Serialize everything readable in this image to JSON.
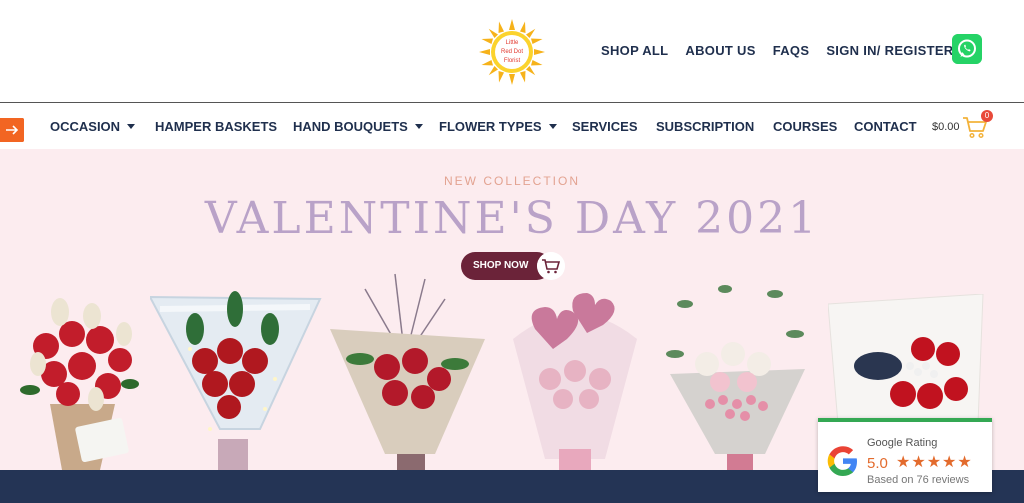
{
  "brand": {
    "logo_text": [
      "Little",
      "Red Dot",
      "Florist"
    ]
  },
  "top_nav": [
    "SHOP ALL",
    "ABOUT US",
    "FAQS",
    "SIGN IN/ REGISTER"
  ],
  "icons": {
    "menu_toggle": "arrow-right-icon",
    "whatsapp": "whatsapp-icon",
    "cart": "cart-icon",
    "google": "google-g-icon"
  },
  "main_nav": {
    "items": [
      {
        "label": "OCCASION",
        "dropdown": true
      },
      {
        "label": "HAMPER BASKETS",
        "dropdown": false
      },
      {
        "label": "HAND BOUQUETS",
        "dropdown": true
      },
      {
        "label": "FLOWER TYPES",
        "dropdown": true
      },
      {
        "label": "SERVICES",
        "dropdown": false
      },
      {
        "label": "SUBSCRIPTION",
        "dropdown": false
      },
      {
        "label": "COURSES",
        "dropdown": false
      },
      {
        "label": "CONTACT",
        "dropdown": false
      }
    ],
    "cart_total": "$0.00",
    "cart_count": "0"
  },
  "hero": {
    "kicker": "NEW COLLECTION",
    "headline": "VALENTINE'S DAY 2021",
    "cta": "SHOP NOW"
  },
  "rating": {
    "title": "Google Rating",
    "score": "5.0",
    "stars": "★★★★★",
    "reviews": "Based on 76 reviews"
  },
  "colors": {
    "nav_text": "#1f2f4d",
    "accent_orange": "#f26522",
    "hero_bg": "#fcecef",
    "headline": "#b9a2c8",
    "cta_bg": "#6b2339",
    "footer_band": "#243455",
    "whatsapp": "#25d366",
    "star": "#e36b2d"
  }
}
